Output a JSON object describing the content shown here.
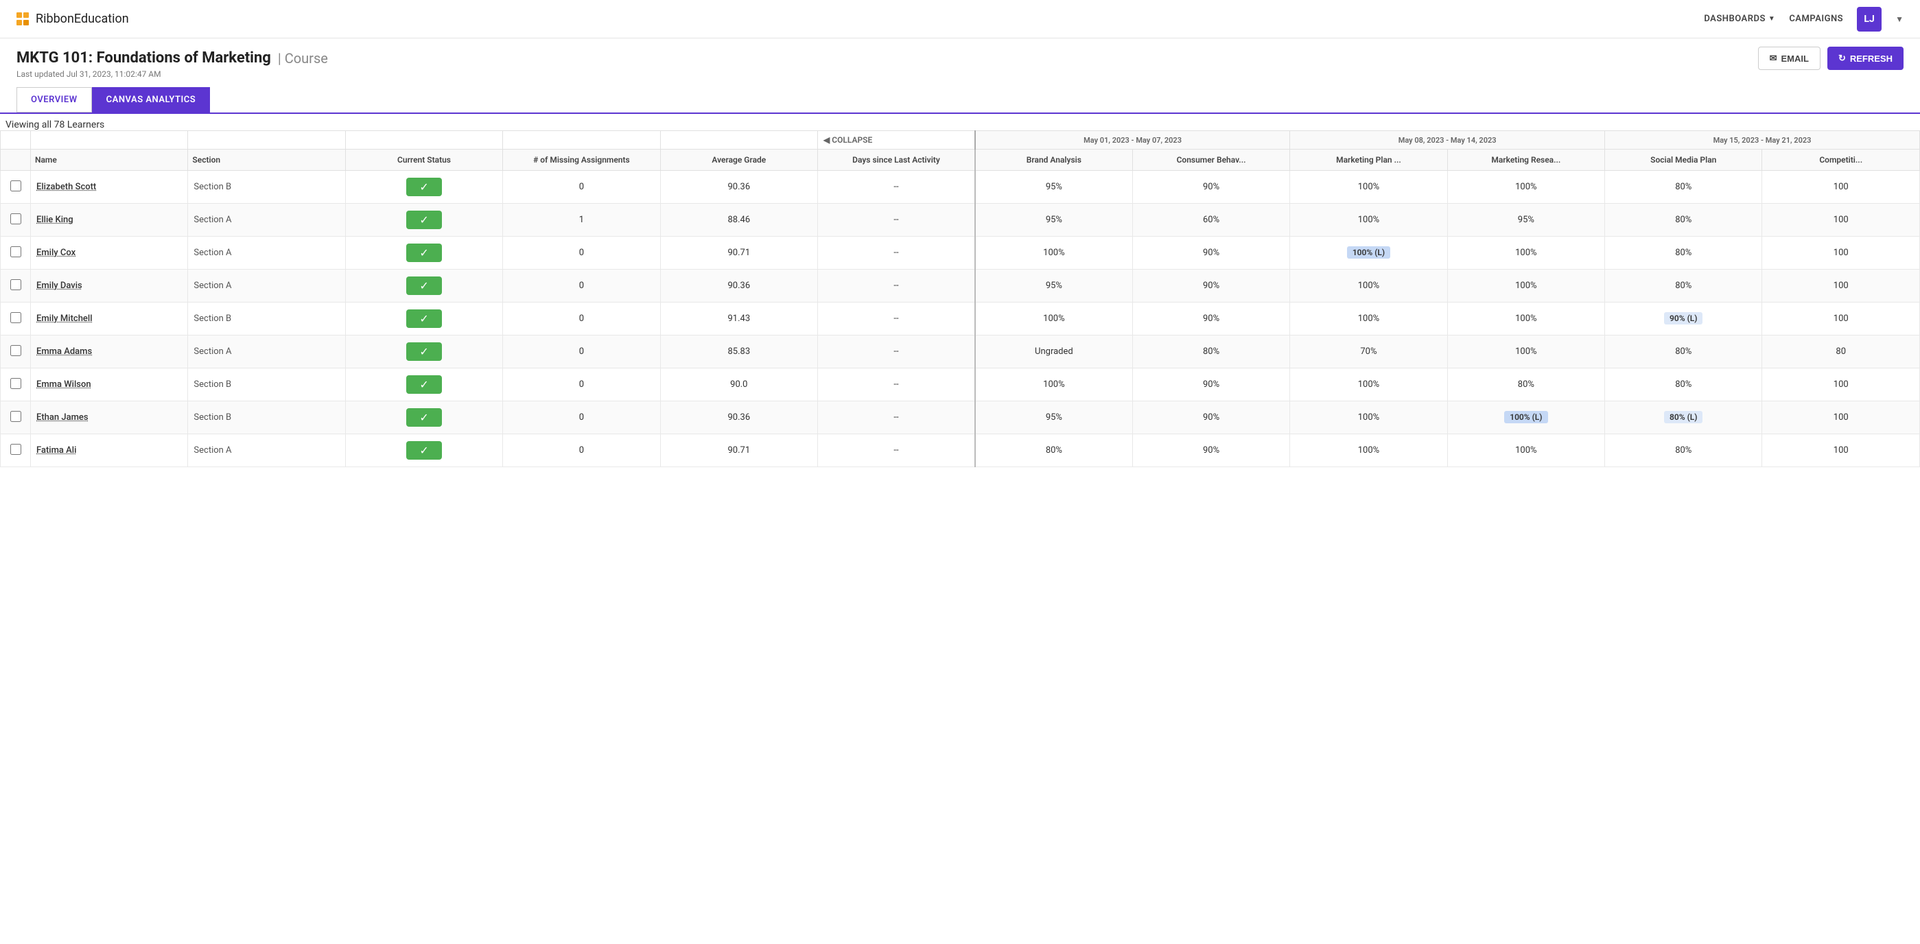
{
  "app": {
    "logo_text": "Ribbon",
    "logo_sub": "Education"
  },
  "nav": {
    "dashboards_label": "DASHBOARDS",
    "campaigns_label": "CAMPAIGNS",
    "avatar_initials": "LJ"
  },
  "course": {
    "title": "MKTG 101: Foundations of Marketing",
    "type": "Course",
    "last_updated": "Last updated Jul 31, 2023, 11:02:47 AM",
    "email_btn": "EMAIL",
    "refresh_btn": "REFRESH"
  },
  "tabs": [
    {
      "id": "overview",
      "label": "OVERVIEW",
      "active": false
    },
    {
      "id": "canvas-analytics",
      "label": "CANVAS ANALYTICS",
      "active": true
    }
  ],
  "viewing": "Viewing all 78 Learners",
  "collapse_label": "◀ COLLAPSE",
  "table": {
    "headers": {
      "name": "Name",
      "section": "Section",
      "current_status": "Current Status",
      "missing_assignments": "# of Missing Assignments",
      "average_grade": "Average Grade",
      "days_since": "Days since Last Activity"
    },
    "date_ranges": [
      {
        "label": "May 01, 2023 - May 07, 2023"
      },
      {
        "label": "May 08, 2023 - May 14, 2023"
      },
      {
        "label": "May 15, 2023 - May 21, 2023"
      }
    ],
    "assignments": [
      "Brand Analysis",
      "Consumer Behav...",
      "Marketing Plan ...",
      "Marketing Resea...",
      "Social Media Plan",
      "Competiti..."
    ],
    "rows": [
      {
        "name": "Elizabeth Scott",
        "section": "Section B",
        "status": "active",
        "missing": "0",
        "grade": "90.36",
        "days": "--",
        "scores": [
          "95%",
          "90%",
          "100%",
          "100%",
          "80%",
          "100"
        ]
      },
      {
        "name": "Ellie King",
        "section": "Section A",
        "status": "active",
        "missing": "1",
        "grade": "88.46",
        "days": "--",
        "scores": [
          "95%",
          "60%",
          "100%",
          "95%",
          "80%",
          "100"
        ]
      },
      {
        "name": "Emily Cox",
        "section": "Section A",
        "status": "active",
        "missing": "0",
        "grade": "90.71",
        "days": "--",
        "scores": [
          "100%",
          "90%",
          "100% (L)",
          "100%",
          "80%",
          "100"
        ],
        "score_highlights": [
          null,
          null,
          "blue",
          null,
          null,
          null
        ]
      },
      {
        "name": "Emily Davis",
        "section": "Section A",
        "status": "active",
        "missing": "0",
        "grade": "90.36",
        "days": "--",
        "scores": [
          "95%",
          "90%",
          "100%",
          "100%",
          "80%",
          "100"
        ],
        "score_highlights": [
          null,
          null,
          null,
          null,
          null,
          null
        ]
      },
      {
        "name": "Emily Mitchell",
        "section": "Section B",
        "status": "active",
        "missing": "0",
        "grade": "91.43",
        "days": "--",
        "scores": [
          "100%",
          "90%",
          "100%",
          "100%",
          "90% (L)",
          "100"
        ],
        "score_highlights": [
          null,
          null,
          null,
          null,
          "light",
          null
        ]
      },
      {
        "name": "Emma Adams",
        "section": "Section A",
        "status": "active",
        "missing": "0",
        "grade": "85.83",
        "days": "--",
        "scores": [
          "Ungraded",
          "80%",
          "70%",
          "100%",
          "80%",
          "80"
        ],
        "score_highlights": [
          null,
          null,
          null,
          null,
          null,
          null
        ]
      },
      {
        "name": "Emma Wilson",
        "section": "Section B",
        "status": "active",
        "missing": "0",
        "grade": "90.0",
        "days": "--",
        "scores": [
          "100%",
          "90%",
          "100%",
          "80%",
          "80%",
          "100"
        ],
        "score_highlights": [
          null,
          null,
          null,
          null,
          null,
          null
        ]
      },
      {
        "name": "Ethan James",
        "section": "Section B",
        "status": "active",
        "missing": "0",
        "grade": "90.36",
        "days": "--",
        "scores": [
          "95%",
          "90%",
          "100%",
          "100% (L)",
          "80% (L)",
          "100"
        ],
        "score_highlights": [
          null,
          null,
          null,
          "blue",
          "light",
          null
        ]
      },
      {
        "name": "Fatima Ali",
        "section": "Section A",
        "status": "active",
        "missing": "0",
        "grade": "90.71",
        "days": "--",
        "scores": [
          "80%",
          "90%",
          "100%",
          "100%",
          "80%",
          "100"
        ],
        "score_highlights": [
          null,
          null,
          null,
          null,
          null,
          null
        ]
      }
    ]
  }
}
